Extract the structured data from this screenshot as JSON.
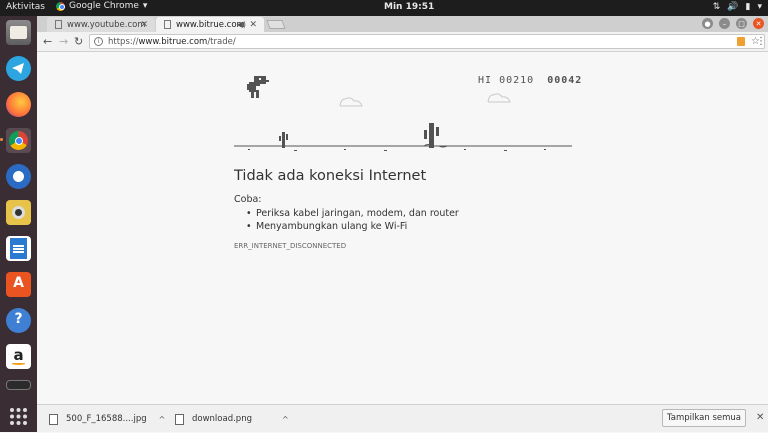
{
  "topbar": {
    "activities": "Aktivitas",
    "app_name": "Google Chrome",
    "app_menu_icon": "chevron-down-icon",
    "clock": "Min 19:51"
  },
  "tabs": [
    {
      "title": "www.youtube.com",
      "active": false
    },
    {
      "title": "www.bitrue.com",
      "active": true,
      "audio": true
    }
  ],
  "toolbar": {
    "url_prefix": "https://",
    "url_host": "www.bitrue.com",
    "url_path": "/trade/"
  },
  "game": {
    "hi_label": "HI",
    "hi_score": "00210",
    "score": "00042"
  },
  "error": {
    "title": "Tidak ada koneksi Internet",
    "try_label": "Coba:",
    "suggestions": [
      "Periksa kabel jaringan, modem, dan router",
      "Menyambungkan ulang ke Wi-Fi"
    ],
    "code": "ERR_INTERNET_DISCONNECTED"
  },
  "downloads": {
    "items": [
      {
        "name": "500_F_16588....jpg"
      },
      {
        "name": "download.png"
      }
    ],
    "show_all": "Tampilkan semua"
  },
  "dock": [
    "files-icon",
    "telegram-icon",
    "firefox-icon",
    "chrome-icon",
    "thunderbird-icon",
    "rhythmbox-icon",
    "writer-icon",
    "software-center-icon",
    "help-icon",
    "amazon-icon",
    "terminal-icon",
    "app-grid-icon"
  ],
  "colors": {
    "dock_bg": "#3a2d34",
    "accent": "#e95420",
    "page_bg": "#f7f7f7",
    "dino": "#535353"
  }
}
